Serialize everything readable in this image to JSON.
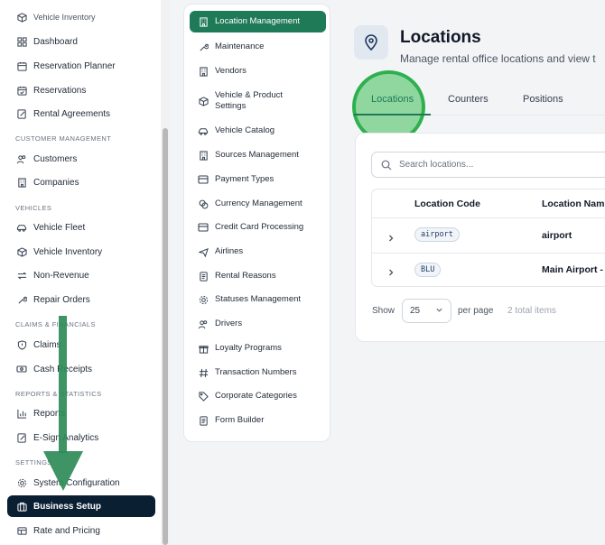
{
  "sidebar": {
    "top_item": "Vehicle Inventory",
    "items": [
      {
        "label": "Dashboard"
      },
      {
        "label": "Reservation Planner"
      },
      {
        "label": "Reservations"
      },
      {
        "label": "Rental Agreements"
      }
    ],
    "section_customer": "CUSTOMER MANAGEMENT",
    "customer_items": [
      {
        "label": "Customers"
      },
      {
        "label": "Companies"
      }
    ],
    "section_vehicles": "VEHICLES",
    "vehicle_items": [
      {
        "label": "Vehicle Fleet"
      },
      {
        "label": "Vehicle Inventory"
      },
      {
        "label": "Non-Revenue"
      },
      {
        "label": "Repair Orders"
      }
    ],
    "section_claims": "CLAIMS & FINANCIALS",
    "claims_items": [
      {
        "label": "Claims"
      },
      {
        "label": "Cash Receipts"
      }
    ],
    "section_reports": "REPORTS & STATISTICS",
    "reports_items": [
      {
        "label": "Reports"
      },
      {
        "label": "E-Sign Analytics"
      }
    ],
    "section_settings": "SETTINGS",
    "settings_items": [
      {
        "label": "System Configuration"
      },
      {
        "label": "Business Setup"
      },
      {
        "label": "Rate and Pricing"
      }
    ]
  },
  "settings_menu": {
    "items": [
      {
        "label": "Location Management"
      },
      {
        "label": "Maintenance"
      },
      {
        "label": "Vendors"
      },
      {
        "label": "Vehicle & Product Settings"
      },
      {
        "label": "Vehicle Catalog"
      },
      {
        "label": "Sources Management"
      },
      {
        "label": "Payment Types"
      },
      {
        "label": "Currency Management"
      },
      {
        "label": "Credit Card Processing"
      },
      {
        "label": "Airlines"
      },
      {
        "label": "Rental Reasons"
      },
      {
        "label": "Statuses Management"
      },
      {
        "label": "Drivers"
      },
      {
        "label": "Loyalty Programs"
      },
      {
        "label": "Transaction Numbers"
      },
      {
        "label": "Corporate Categories"
      },
      {
        "label": "Form Builder"
      }
    ]
  },
  "main": {
    "title": "Locations",
    "subtitle": "Manage rental office locations and view t",
    "tabs": [
      {
        "label": "Locations"
      },
      {
        "label": "Counters"
      },
      {
        "label": "Positions"
      }
    ],
    "search": {
      "placeholder": "Search locations..."
    },
    "table": {
      "headers": [
        "Location Code",
        "Location Nam"
      ],
      "rows": [
        {
          "code": "airport",
          "name": "airport"
        },
        {
          "code": "BLU",
          "name": "Main Airport -"
        }
      ]
    },
    "pagination": {
      "show_label": "Show",
      "per_page_value": "25",
      "per_page_label": "per page",
      "total": "2 total items"
    }
  },
  "colors": {
    "accent": "#1f7a57",
    "active_sidebar": "#0b1f33",
    "highlight": "#2fb04f"
  }
}
